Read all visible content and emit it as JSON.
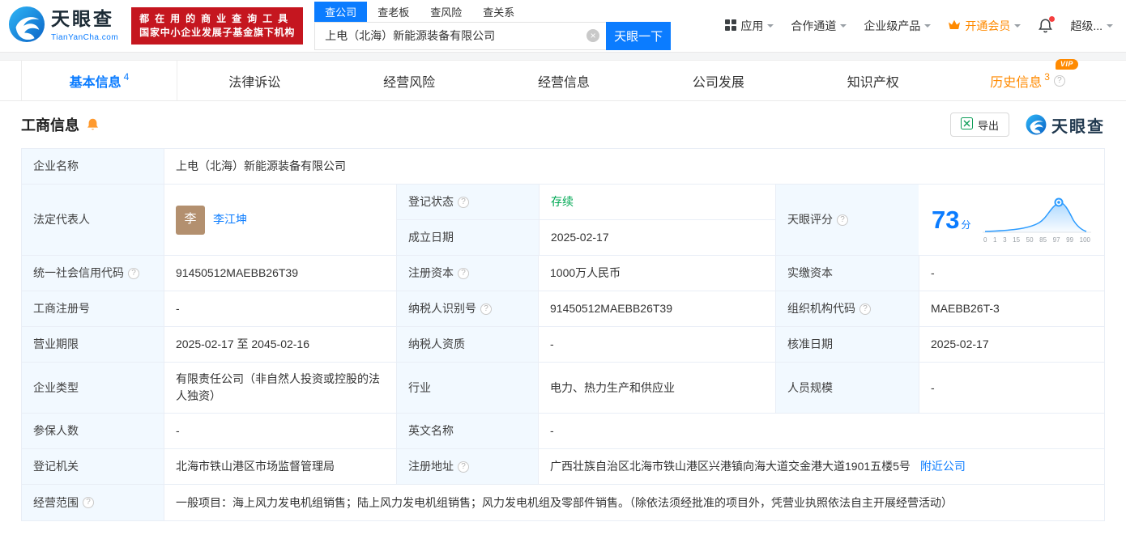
{
  "header": {
    "logo": {
      "name": "天眼查",
      "domain": "TianYanCha.com"
    },
    "slogan": {
      "line1": "都在用的商业查询工具",
      "line2": "国家中小企业发展子基金旗下机构"
    },
    "search": {
      "tabs": [
        {
          "label": "查公司"
        },
        {
          "label": "查老板"
        },
        {
          "label": "查风险"
        },
        {
          "label": "查关系"
        }
      ],
      "value": "上电（北海）新能源装备有限公司",
      "button": "天眼一下"
    },
    "nav": {
      "apps": "应用",
      "partner": "合作通道",
      "enterprise": "企业级产品",
      "vip": "开通会员",
      "user": "超级..."
    }
  },
  "tabs": {
    "basic": {
      "label": "基本信息",
      "count": "4"
    },
    "legal": {
      "label": "法律诉讼"
    },
    "risk": {
      "label": "经营风险"
    },
    "operation": {
      "label": "经营信息"
    },
    "development": {
      "label": "公司发展"
    },
    "ip": {
      "label": "知识产权"
    },
    "history": {
      "label": "历史信息",
      "count": "3",
      "vip_badge": "VIP"
    }
  },
  "section": {
    "title": "工商信息",
    "export": "导出",
    "brand": "天眼查"
  },
  "info": {
    "company_name": {
      "label": "企业名称",
      "value": "上电（北海）新能源装备有限公司"
    },
    "legal_rep": {
      "label": "法定代表人",
      "avatar": "李",
      "name": "李江坤"
    },
    "reg_status": {
      "label": "登记状态",
      "value": "存续"
    },
    "est_date": {
      "label": "成立日期",
      "value": "2025-02-17"
    },
    "score": {
      "label": "天眼评分",
      "value": "73",
      "unit": "分",
      "ticks": [
        "0",
        "1",
        "3",
        "15",
        "50",
        "85",
        "97",
        "99",
        "100"
      ]
    },
    "credit_code": {
      "label": "统一社会信用代码",
      "value": "91450512MAEBB26T39"
    },
    "reg_capital": {
      "label": "注册资本",
      "value": "1000万人民币"
    },
    "paid_capital": {
      "label": "实缴资本",
      "value": "-"
    },
    "reg_number": {
      "label": "工商注册号",
      "value": "-"
    },
    "taxpayer_id": {
      "label": "纳税人识别号",
      "value": "91450512MAEBB26T39"
    },
    "org_code": {
      "label": "组织机构代码",
      "value": "MAEBB26T-3"
    },
    "business_term": {
      "label": "营业期限",
      "value": "2025-02-17 至 2045-02-16"
    },
    "taxpayer_quality": {
      "label": "纳税人资质",
      "value": "-"
    },
    "approval_date": {
      "label": "核准日期",
      "value": "2025-02-17"
    },
    "company_type": {
      "label": "企业类型",
      "value": "有限责任公司（非自然人投资或控股的法人独资）"
    },
    "industry": {
      "label": "行业",
      "value": "电力、热力生产和供应业"
    },
    "staff_size": {
      "label": "人员规模",
      "value": "-"
    },
    "insured_count": {
      "label": "参保人数",
      "value": "-"
    },
    "english_name": {
      "label": "英文名称",
      "value": "-"
    },
    "reg_authority": {
      "label": "登记机关",
      "value": "北海市铁山港区市场监督管理局"
    },
    "reg_address": {
      "label": "注册地址",
      "value": "广西壮族自治区北海市铁山港区兴港镇向海大道交金港大道1901五楼5号",
      "link": "附近公司"
    },
    "business_scope": {
      "label": "经营范围",
      "value": "一般项目：海上风力发电机组销售；陆上风力发电机组销售；风力发电机组及零部件销售。（除依法须经批准的项目外，凭营业执照依法自主开展经营活动）"
    }
  }
}
